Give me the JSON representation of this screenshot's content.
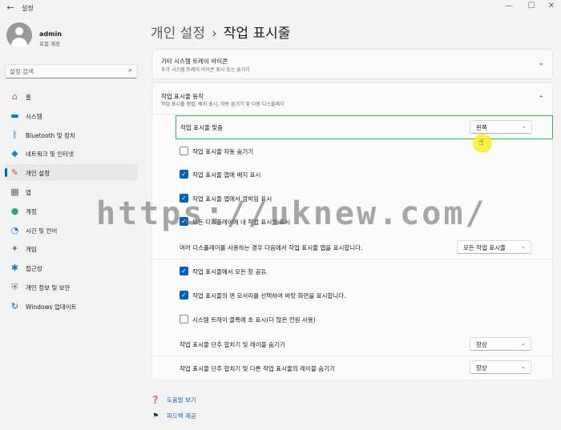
{
  "window": {
    "title": "설정",
    "back_glyph": "←",
    "minimize_glyph": "—",
    "maximize_glyph": "☐",
    "close_glyph": "✕"
  },
  "profile": {
    "name": "admin",
    "account_type": "로컬 계정"
  },
  "search": {
    "placeholder": "설정 검색",
    "icon": "search-icon"
  },
  "sidebar": {
    "items": [
      {
        "label": "홈",
        "icon": "home-icon",
        "glyph": "⌂",
        "color": "#d6562b"
      },
      {
        "label": "시스템",
        "icon": "system-monitor-icon",
        "glyph": "▬",
        "color": "#0078d4"
      },
      {
        "label": "Bluetooth 및 장치",
        "icon": "bluetooth-icon",
        "glyph": "ᛒ",
        "color": "#0067c0"
      },
      {
        "label": "네트워크 및 인터넷",
        "icon": "wifi-icon",
        "glyph": "◆",
        "color": "#1a86d9"
      },
      {
        "label": "개인 설정",
        "icon": "brush-icon",
        "glyph": "✎",
        "color": "#c2551b",
        "active": true
      },
      {
        "label": "앱",
        "icon": "apps-icon",
        "glyph": "▦",
        "color": "#5d6b7d"
      },
      {
        "label": "계정",
        "icon": "account-icon",
        "glyph": "●",
        "color": "#2aa876"
      },
      {
        "label": "시간 및 언어",
        "icon": "globe-clock-icon",
        "glyph": "◔",
        "color": "#1b7fd1"
      },
      {
        "label": "게임",
        "icon": "gamepad-icon",
        "glyph": "✦",
        "color": "#6d7a8a"
      },
      {
        "label": "접근성",
        "icon": "accessibility-icon",
        "glyph": "✱",
        "color": "#1a73c9"
      },
      {
        "label": "개인 정보 및 보안",
        "icon": "shield-icon",
        "glyph": "⛨",
        "color": "#6b6b6b"
      },
      {
        "label": "Windows 업데이트",
        "icon": "update-icon",
        "glyph": "↻",
        "color": "#0067c0"
      }
    ]
  },
  "header": {
    "breadcrumb_parent": "개인 설정",
    "separator": "›",
    "title": "작업 표시줄"
  },
  "sections": {
    "tray_icons": {
      "title": "기타 시스템 트레이 아이콘",
      "subtitle": "추가 시스템 트레이 아이콘 표시 또는 숨기기",
      "chevron": "⌄"
    },
    "behaviors": {
      "title": "작업 표시줄 동작",
      "subtitle": "작업 표시줄 정렬, 배지 표시, 자동 숨기기 및 다중 디스플레이",
      "chevron": "⌃"
    }
  },
  "settings": {
    "alignment": {
      "label": "작업 표시줄 맞춤",
      "value": "왼쪽"
    },
    "auto_hide": {
      "label": "작업 표시줄 자동 숨기기",
      "checked": false
    },
    "badges": {
      "label": "작업 표시줄 앱에 배지 표시",
      "checked": true
    },
    "flashing": {
      "label": "작업 표시줄 앱에서 깜박임 표시",
      "checked": true
    },
    "all_displays": {
      "label": "모든 디스플레이에 내 작업 표시줄 표시",
      "checked": true
    },
    "multi_display_apps": {
      "label": "여러 디스플레이를 사용하는 경우 다음에서 작업 표시줄 앱을 표시합니다.",
      "value": "모든 작업 표시줄"
    },
    "share_window": {
      "label": "작업 표시줄에서 모든 창 공유",
      "checked": true
    },
    "corner_desktop": {
      "label": "작업 표시줄의 맨 모서리를 선택하여 바탕 화면을 표시합니다.",
      "checked": true
    },
    "tray_seconds": {
      "label": "시스템 트레이 클록에 초 표시(더 많은 전원 사용)",
      "checked": false
    },
    "combine_buttons": {
      "label": "작업 표시줄 단추 합치기 및 레이블 숨기기",
      "value": "항상"
    },
    "combine_other": {
      "label": "작업 표시줄 단추 합치기 및 다른 작업 표시줄의 레이블 숨기기",
      "value": "항상"
    }
  },
  "footer": {
    "help": {
      "label": "도움말 보기",
      "icon": "help-icon"
    },
    "feedback": {
      "label": "피드백 제공",
      "icon": "feedback-icon"
    }
  },
  "watermark": "https://uknew.com/",
  "colors": {
    "accent": "#005fb8",
    "highlight_border": "#3bb54a",
    "cursor_highlight": "#faf028"
  }
}
